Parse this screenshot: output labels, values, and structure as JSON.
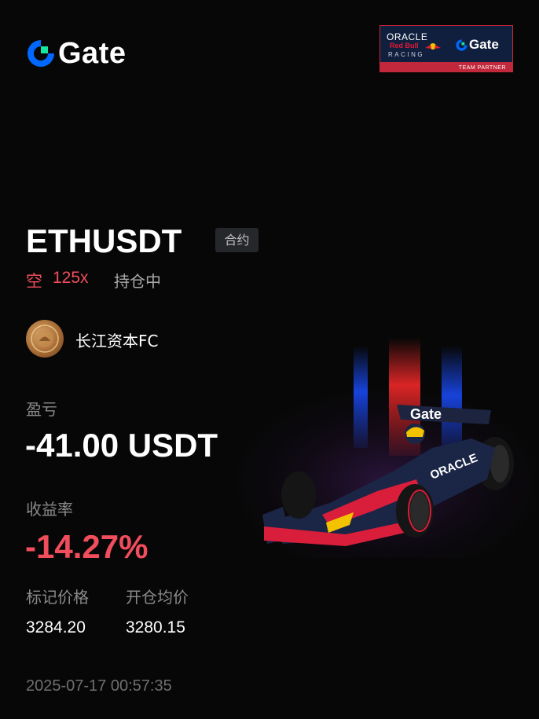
{
  "brand": {
    "name": "Gate",
    "accent": "#0068ff",
    "accent_green": "#17e5a2"
  },
  "partner_badge": {
    "line1": "ORACLE",
    "line2": "Red Bull",
    "line3": "RACING",
    "gate_label": "Gate",
    "strip": "TEAM PARTNER"
  },
  "position": {
    "pair": "ETHUSDT",
    "type_tag": "合约",
    "direction": "空",
    "leverage": "125x",
    "status": "持仓中"
  },
  "user": {
    "nickname": "长江资本FC"
  },
  "pnl": {
    "label": "盈亏",
    "value": "-41.00 USDT"
  },
  "roi": {
    "label": "收益率",
    "value": "-14.27%"
  },
  "prices": {
    "mark_label": "标记价格",
    "mark_value": "3284.20",
    "entry_label": "开仓均价",
    "entry_value": "3280.15"
  },
  "timestamp": "2025-07-17 00:57:35",
  "car_livery_text": {
    "wing": "Gate",
    "side": "ORACLE"
  },
  "colors": {
    "negative": "#f24d5c",
    "muted": "#8a8a8a",
    "background": "#070707"
  }
}
